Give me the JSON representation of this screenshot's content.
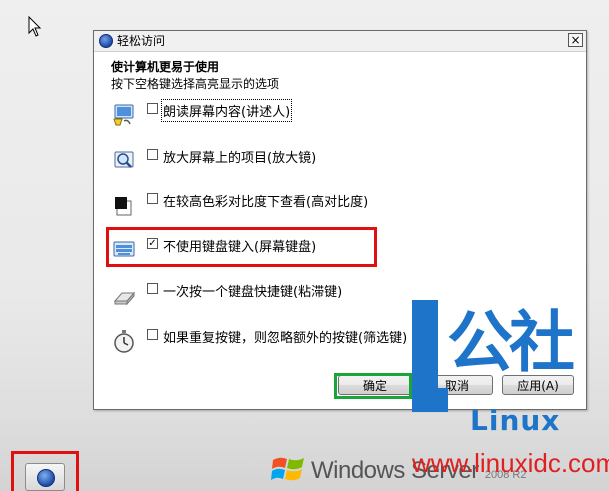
{
  "dialog": {
    "title": "轻松访问",
    "close_glyph": "×",
    "heading": "使计算机更易于使用",
    "subheading": "按下空格键选择高亮显示的选项",
    "options": [
      {
        "label": "朗读屏幕内容(讲述人)",
        "checked": false,
        "icon": "narrator-icon"
      },
      {
        "label": "放大屏幕上的项目(放大镜)",
        "checked": false,
        "icon": "magnifier-icon"
      },
      {
        "label": "在较高色彩对比度下查看(高对比度)",
        "checked": false,
        "icon": "high-contrast-icon"
      },
      {
        "label": "不使用键盘键入(屏幕键盘)",
        "checked": true,
        "icon": "on-screen-keyboard-icon"
      },
      {
        "label": "一次按一个键盘快捷键(粘滞键)",
        "checked": false,
        "icon": "sticky-keys-icon"
      },
      {
        "label": "如果重复按键，则忽略额外的按键(筛选键)",
        "checked": false,
        "icon": "filter-keys-icon"
      }
    ],
    "buttons": {
      "ok": "确定",
      "cancel": "取消",
      "apply": "应用(A)"
    }
  },
  "taskbar": {
    "ease_of_access_icon": "ease-of-access-icon"
  },
  "branding": {
    "windows": "Windows Server",
    "version": "2008 R2"
  },
  "watermark": {
    "chars": "公社",
    "linux": "Linux",
    "url": "www.linuxidc.com"
  },
  "colors": {
    "annotation_red": "#e01010",
    "annotation_green": "#1aa53a",
    "watermark_blue": "#1e74c8"
  }
}
